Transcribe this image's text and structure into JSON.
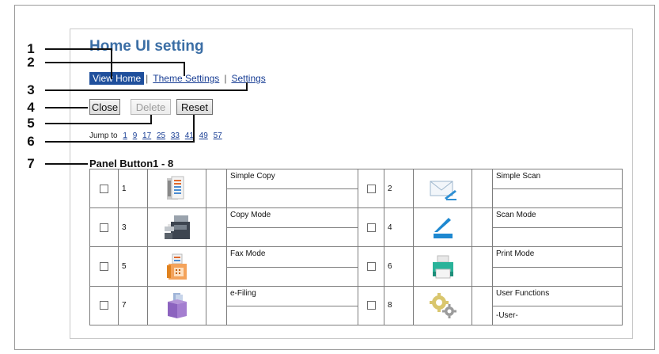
{
  "page": {
    "title": "Home UI setting",
    "tabs": [
      {
        "label": "View Home",
        "active": true
      },
      {
        "label": "Theme Settings",
        "active": false
      },
      {
        "label": "Settings",
        "active": false
      }
    ],
    "buttons": {
      "close": "Close",
      "delete": "Delete",
      "reset": "Reset"
    },
    "jump": {
      "prefix": "Jump to",
      "links": [
        "1",
        "9",
        "17",
        "25",
        "33",
        "41",
        "49",
        "57"
      ]
    },
    "section_title": "Panel Button1 - 8",
    "rows": [
      {
        "left": {
          "num": "1",
          "label": "Simple Copy",
          "sublabel": "",
          "icon": "simple-copy-icon"
        },
        "right": {
          "num": "2",
          "label": "Simple Scan",
          "sublabel": "",
          "icon": "simple-scan-icon"
        }
      },
      {
        "left": {
          "num": "3",
          "label": "Copy Mode",
          "sublabel": "",
          "icon": "copy-mode-icon"
        },
        "right": {
          "num": "4",
          "label": "Scan Mode",
          "sublabel": "",
          "icon": "scan-mode-icon"
        }
      },
      {
        "left": {
          "num": "5",
          "label": "Fax Mode",
          "sublabel": "",
          "icon": "fax-mode-icon"
        },
        "right": {
          "num": "6",
          "label": "Print Mode",
          "sublabel": "",
          "icon": "print-mode-icon"
        }
      },
      {
        "left": {
          "num": "7",
          "label": "e-Filing",
          "sublabel": "",
          "icon": "e-filing-icon"
        },
        "right": {
          "num": "8",
          "label": "User Functions",
          "sublabel": "-User-",
          "icon": "user-functions-icon"
        }
      }
    ]
  },
  "callouts": [
    "1",
    "2",
    "3",
    "4",
    "5",
    "6",
    "7"
  ],
  "colors": {
    "accent": "#1f4f9c",
    "title": "#3b6ea5",
    "link": "#1a3f95"
  }
}
